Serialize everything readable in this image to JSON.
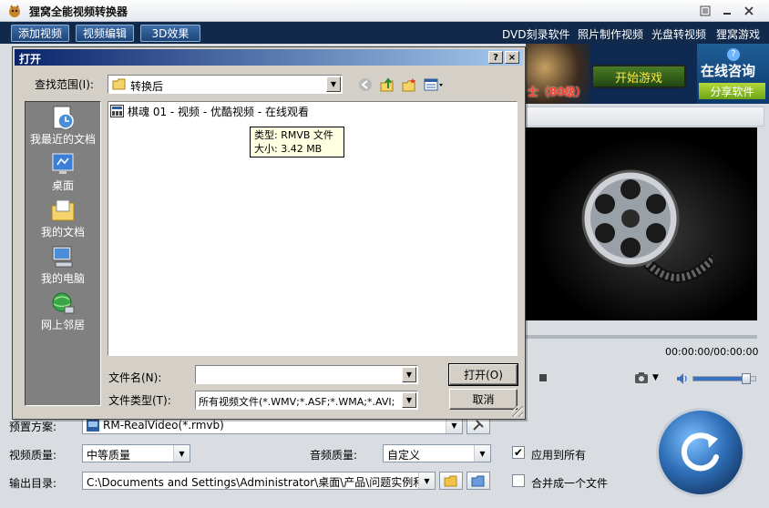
{
  "app": {
    "title": "狸窝全能视频转换器",
    "accent": "#11294a"
  },
  "toolbar": {
    "add_video": "添加视频",
    "edit_video": "视频编辑",
    "effect_3d": "3D效果",
    "links": [
      "DVD刻录软件",
      "照片制作视频",
      "光盘转视频",
      "狸窝游戏"
    ]
  },
  "banner": {
    "level_text": "士（80级）",
    "game_button": "开始游戏",
    "consult": "在线咨询",
    "consult_icon": "?",
    "share": "分享软件"
  },
  "preview": {
    "time": "00:00:00/00:00:00",
    "volume": 0.85
  },
  "settings": {
    "preset_label": "预置方案:",
    "preset_value": "RM-RealVideo(*.rmvb)",
    "video_quality_label": "视频质量:",
    "video_quality_value": "中等质量",
    "audio_quality_label": "音频质量:",
    "audio_quality_value": "自定义",
    "apply_all": "应用到所有",
    "apply_all_checked": true,
    "output_label": "输出目录:",
    "output_value": "C:\\Documents and Settings\\Administrator\\桌面\\产品\\问题实例和...",
    "merge": "合并成一个文件",
    "merge_checked": false
  },
  "dialog": {
    "title": "打开",
    "help": "?",
    "close": "×",
    "look_in_label": "查找范围(I):",
    "look_in_value": "转换后",
    "places": [
      "我最近的文档",
      "桌面",
      "我的文档",
      "我的电脑",
      "网上邻居"
    ],
    "file": "棋魂 01 - 视频 - 优酷视频 - 在线观看",
    "tooltip_type": "类型: RMVB 文件",
    "tooltip_size": "大小: 3.42 MB",
    "filename_label": "文件名(N):",
    "filename_value": "",
    "filetype_label": "文件类型(T):",
    "filetype_value": "所有视频文件(*.WMV;*.ASF;*.WMA;*.AVI;",
    "open": "打开(O)",
    "cancel": "取消"
  }
}
